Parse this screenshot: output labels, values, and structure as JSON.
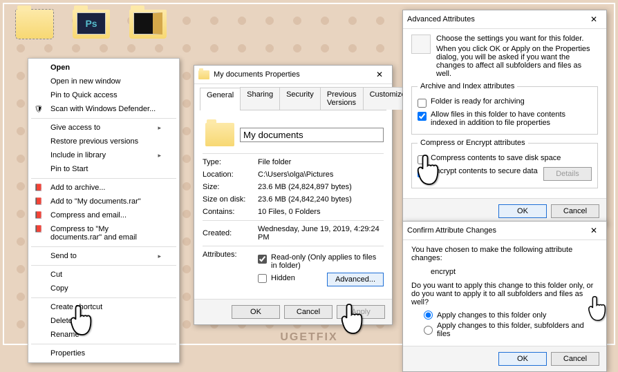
{
  "context_menu": {
    "items": [
      {
        "label": "Open",
        "bold": true
      },
      {
        "label": "Open in new window"
      },
      {
        "label": "Pin to Quick access"
      },
      {
        "label": "Scan with Windows Defender...",
        "icon": "🛡"
      },
      {
        "sep": true
      },
      {
        "label": "Give access to",
        "sub": true
      },
      {
        "label": "Restore previous versions"
      },
      {
        "label": "Include in library",
        "sub": true
      },
      {
        "label": "Pin to Start"
      },
      {
        "sep": true
      },
      {
        "label": "Add to archive...",
        "icon": "📕"
      },
      {
        "label": "Add to \"My documents.rar\"",
        "icon": "📕"
      },
      {
        "label": "Compress and email...",
        "icon": "📕"
      },
      {
        "label": "Compress to \"My documents.rar\" and email",
        "icon": "📕"
      },
      {
        "sep": true
      },
      {
        "label": "Send to",
        "sub": true
      },
      {
        "sep": true
      },
      {
        "label": "Cut"
      },
      {
        "label": "Copy"
      },
      {
        "sep": true
      },
      {
        "label": "Create shortcut"
      },
      {
        "label": "Delete"
      },
      {
        "label": "Rename"
      },
      {
        "sep": true
      },
      {
        "label": "Properties"
      }
    ]
  },
  "properties": {
    "title": "My documents Properties",
    "tabs": [
      "General",
      "Sharing",
      "Security",
      "Previous Versions",
      "Customize"
    ],
    "name": "My documents",
    "type_label": "Type:",
    "type": "File folder",
    "location_label": "Location:",
    "location": "C:\\Users\\olga\\Pictures",
    "size_label": "Size:",
    "size": "23.6 MB (24,824,897 bytes)",
    "sizeondisk_label": "Size on disk:",
    "sizeondisk": "23.6 MB (24,842,240 bytes)",
    "contains_label": "Contains:",
    "contains": "10 Files, 0 Folders",
    "created_label": "Created:",
    "created": "Wednesday, June 19, 2019, 4:29:24 PM",
    "attributes_label": "Attributes:",
    "readonly": "Read-only (Only applies to files in folder)",
    "hidden": "Hidden",
    "advanced_btn": "Advanced...",
    "ok": "OK",
    "cancel": "Cancel",
    "apply": "Apply"
  },
  "advanced": {
    "title": "Advanced Attributes",
    "intro1": "Choose the settings you want for this folder.",
    "intro2": "When you click OK or Apply on the Properties dialog, you will be asked if you want the changes to affect all subfolders and files as well.",
    "group1": "Archive and Index attributes",
    "archive": "Folder is ready for archiving",
    "index": "Allow files in this folder to have contents indexed in addition to file properties",
    "group2": "Compress or Encrypt attributes",
    "compress": "Compress contents to save disk space",
    "encrypt": "Encrypt contents to secure data",
    "details": "Details",
    "ok": "OK",
    "cancel": "Cancel"
  },
  "confirm": {
    "title": "Confirm Attribute Changes",
    "line1": "You have chosen to make the following attribute changes:",
    "change": "encrypt",
    "line2": "Do you want to apply this change to this folder only, or do you want to apply it to all subfolders and files as well?",
    "opt1": "Apply changes to this folder only",
    "opt2": "Apply changes to this folder, subfolders and files",
    "ok": "OK",
    "cancel": "Cancel"
  },
  "watermark": "UGETFIX"
}
